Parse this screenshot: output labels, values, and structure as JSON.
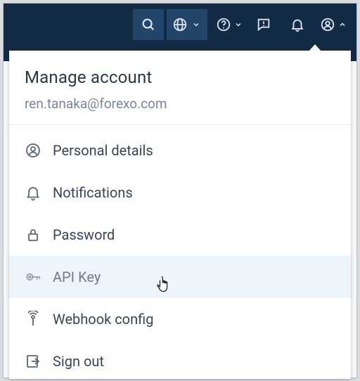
{
  "dropdown": {
    "title": "Manage account",
    "email": "ren.tanaka@forexo.com",
    "items": [
      {
        "label": "Personal details"
      },
      {
        "label": "Notifications"
      },
      {
        "label": "Password"
      },
      {
        "label": "API Key"
      },
      {
        "label": "Webhook config"
      },
      {
        "label": "Sign out"
      }
    ]
  }
}
